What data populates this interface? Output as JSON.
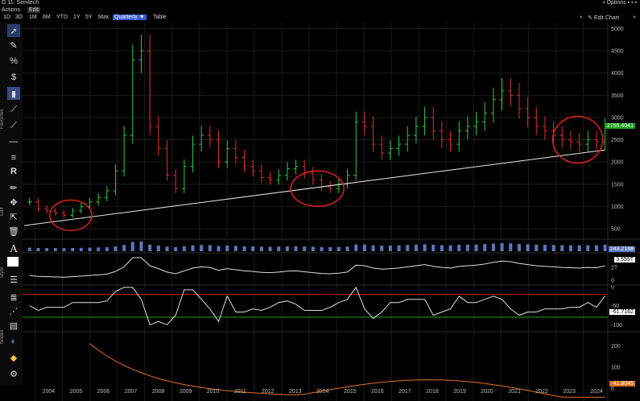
{
  "window": {
    "title": "G 11: Semtech",
    "options_label": "Options"
  },
  "menu": {
    "actions": "Actions",
    "edit": "Edit"
  },
  "toolbar": {
    "ranges": [
      "1D",
      "3D",
      "1M",
      "6M",
      "YTD",
      "1Y",
      "5Y",
      "Max"
    ],
    "period_dropdown": "Quarterly",
    "table": "Table",
    "edit_chart": "Edit Chart"
  },
  "sidebar": {
    "labels": {
      "favorites": "Favorites",
      "edit": "Edit",
      "style": "Style",
      "nodes": "Nodes"
    }
  },
  "chart_data": {
    "type": "candlestick",
    "x_labels": [
      "2004",
      "2005",
      "2006",
      "2007",
      "2008",
      "2009",
      "2010",
      "2011",
      "2012",
      "2013",
      "2014",
      "2015",
      "2016",
      "2017",
      "2018",
      "2019",
      "2020",
      "2021",
      "2022",
      "2023",
      "2024"
    ],
    "price_panel": {
      "y_ticks": [
        500,
        1000,
        1500,
        2000,
        2500,
        3000,
        3500,
        4000,
        4500,
        5000
      ],
      "last_value": "2755.4041",
      "last_color": "#19a319",
      "closes": [
        1100,
        950,
        900,
        850,
        800,
        900,
        1000,
        1100,
        1200,
        1350,
        1800,
        2600,
        4300,
        4500,
        2800,
        2300,
        1700,
        1400,
        1900,
        2400,
        2600,
        2500,
        2000,
        2300,
        2100,
        1900,
        1800,
        1650,
        1600,
        1700,
        1850,
        1900,
        1750,
        1600,
        1450,
        1400,
        1500,
        1700,
        2900,
        2800,
        2400,
        2200,
        2300,
        2400,
        2600,
        2800,
        3000,
        2700,
        2500,
        2400,
        2700,
        2800,
        2900,
        3100,
        3400,
        3600,
        3500,
        3200,
        3000,
        2800,
        2700,
        2600,
        2500,
        2450,
        2400,
        2500,
        2450,
        2755
      ],
      "trendline": {
        "from_year": 2003.6,
        "from_value": 570,
        "to_year": 2024.8,
        "to_value": 2270
      }
    },
    "volume_panel": {
      "last_value": "243.2188",
      "last_color": "#5a78c0"
    },
    "line_panel": {
      "y_ticks": [
        "0",
        "2T"
      ],
      "last_value": "3.559T",
      "last_color": "#cccccc"
    },
    "osc_panel": {
      "y_ticks": [
        0,
        -50,
        -100
      ],
      "last_value": "-61.7162",
      "last_color": "#cccccc"
    },
    "bottom_panel": {
      "y_ticks": [
        0,
        100,
        200
      ],
      "last_value": "-41.8045",
      "last_color": "#e07020"
    }
  }
}
